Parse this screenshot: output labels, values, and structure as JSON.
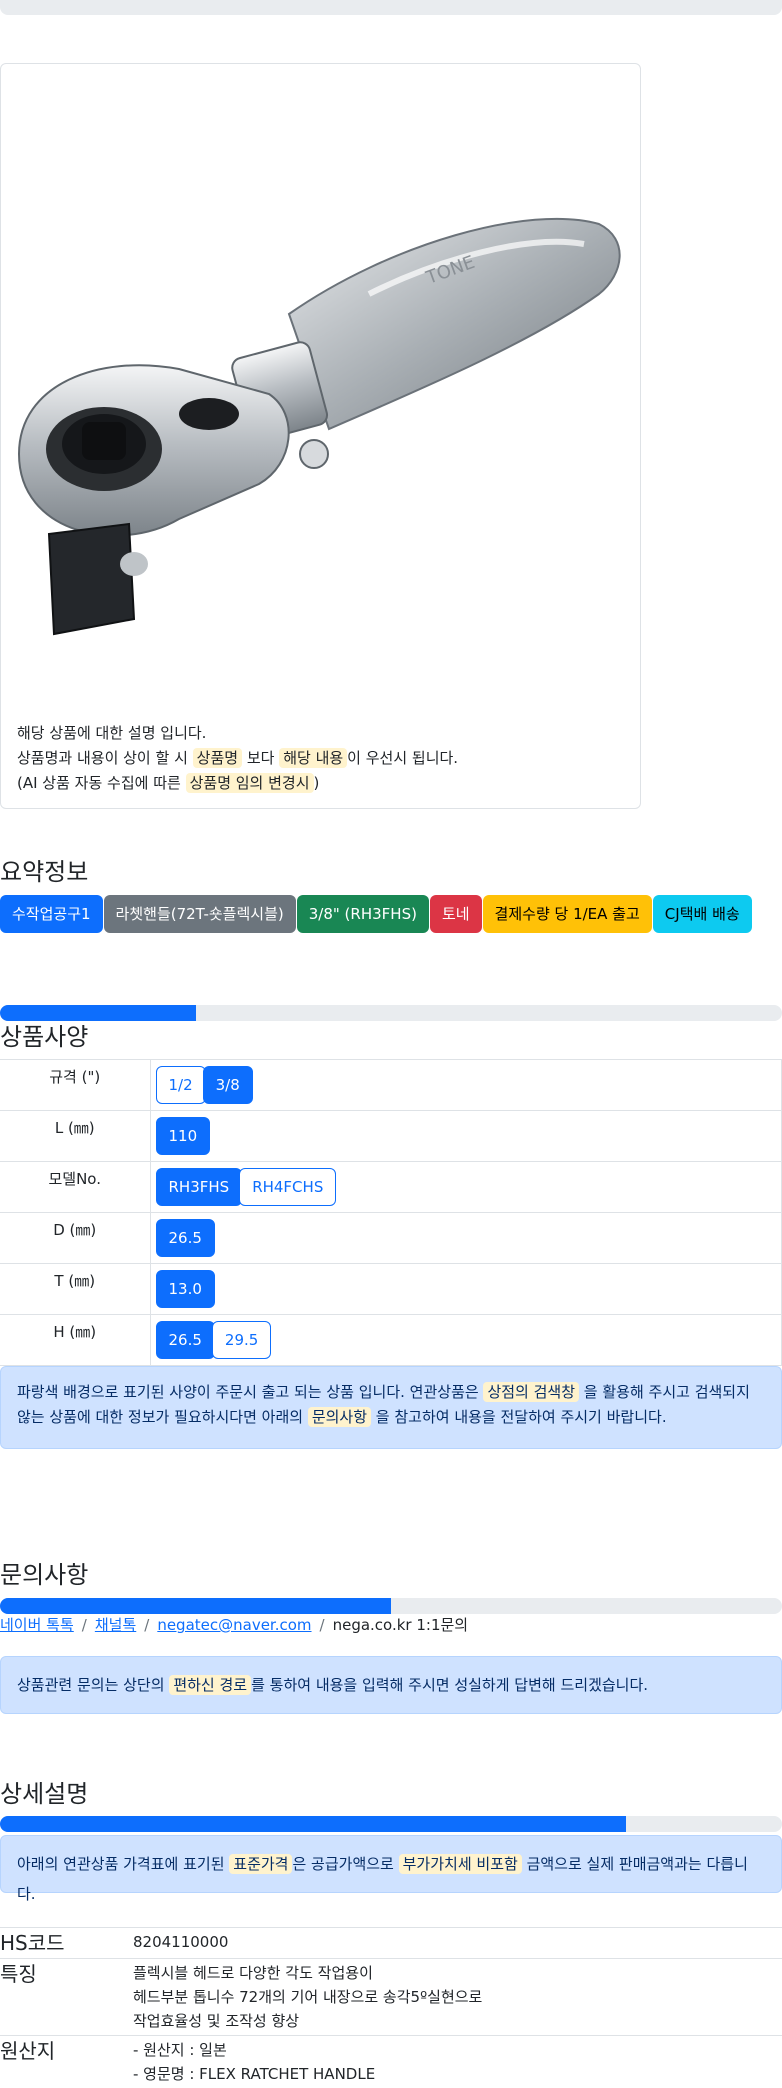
{
  "product": {
    "desc_line1": "해당 상품에 대한 설명 입니다.",
    "desc_line2_a": "상품명과 내용이 상이 할 시 ",
    "desc_line2_hl1": "상품명",
    "desc_line2_b": " 보다 ",
    "desc_line2_hl2": "해당 내용",
    "desc_line2_c": "이 우선시 됩니다.",
    "desc_line3_a": "(AI 상품 자동 수집에 따른 ",
    "desc_line3_hl": "상품명 임의 변경시",
    "desc_line3_b": ")",
    "brand_engraving": "TONE"
  },
  "summary": {
    "title": "요약정보",
    "badges": [
      {
        "label": "수작업공구1",
        "color": "#0d6efd"
      },
      {
        "label": "라쳇핸들(72T-숏플렉시블)",
        "color": "#6c757d"
      },
      {
        "label": "3/8\" (RH3FHS)",
        "color": "#198754"
      },
      {
        "label": "토네",
        "color": "#dc3545"
      },
      {
        "label": "결제수량 당 1/EA 출고",
        "color": "#ffc107"
      },
      {
        "label": "CJ택배 배송",
        "color": "#0dcaf0"
      }
    ]
  },
  "spec": {
    "title": "상품사양",
    "progress_fraction": 0.25,
    "rows": [
      {
        "label": "규격 (\")",
        "options": [
          {
            "v": "1/2",
            "selected": false
          },
          {
            "v": "3/8",
            "selected": true
          }
        ]
      },
      {
        "label": "L (㎜)",
        "options": [
          {
            "v": "110",
            "selected": true
          }
        ]
      },
      {
        "label": "모델No.",
        "options": [
          {
            "v": "RH3FHS",
            "selected": true
          },
          {
            "v": "RH4FCHS",
            "selected": false
          }
        ]
      },
      {
        "label": "D (㎜)",
        "options": [
          {
            "v": "26.5",
            "selected": true
          }
        ]
      },
      {
        "label": "T (㎜)",
        "options": [
          {
            "v": "13.0",
            "selected": true
          }
        ]
      },
      {
        "label": "H (㎜)",
        "options": [
          {
            "v": "26.5",
            "selected": true
          },
          {
            "v": "29.5",
            "selected": false
          }
        ]
      }
    ],
    "notice_a": "파랑색 배경으로 표기된 사양이 주문시 출고 되는 상품 입니다. 연관상품은 ",
    "notice_hl1": "상점의 검색창",
    "notice_b": " 을 활용해 주시고 검색되지 않는 상품에 대한 정보가 필요하시다면 아래의 ",
    "notice_hl2": "문의사항",
    "notice_c": " 을 참고하여 내용을 전달하여 주시기 바랍니다."
  },
  "inquiry": {
    "title": "문의사항",
    "progress_fraction": 0.5,
    "link_naver": "네이버 톡톡",
    "link_channel": "채널톡",
    "link_email": "negatec@naver.com",
    "site_text": "nega.co.kr 1:1문의",
    "notice_a": "상품관련 문의는 상단의 ",
    "notice_hl": "편하신 경로",
    "notice_b": "를 통하여 내용을 입력해 주시면 성실하게 답변해 드리겠습니다."
  },
  "detail": {
    "title": "상세설명",
    "progress_fraction": 0.8,
    "notice_a": "아래의 연관상품 가격표에 표기된 ",
    "notice_hl1": "표준가격",
    "notice_b": "은 공급가액으로 ",
    "notice_hl2": "부가가치세 비포함",
    "notice_c": " 금액으로 실제 판매금액과는 다릅니다.",
    "rows": [
      {
        "key": "HS코드",
        "lines": [
          "8204110000"
        ]
      },
      {
        "key": "특징",
        "lines": [
          "플렉시블 헤드로 다양한 각도 작업용이",
          "헤드부분 톱니수 72개의 기어 내장으로 송각5º실현으로",
          "작업효율성 및 조작성 향상"
        ]
      },
      {
        "key": "원산지",
        "lines": [
          "- 원산지 : 일본",
          "- 영문명 : FLEX RATCHET HANDLE"
        ]
      }
    ]
  }
}
